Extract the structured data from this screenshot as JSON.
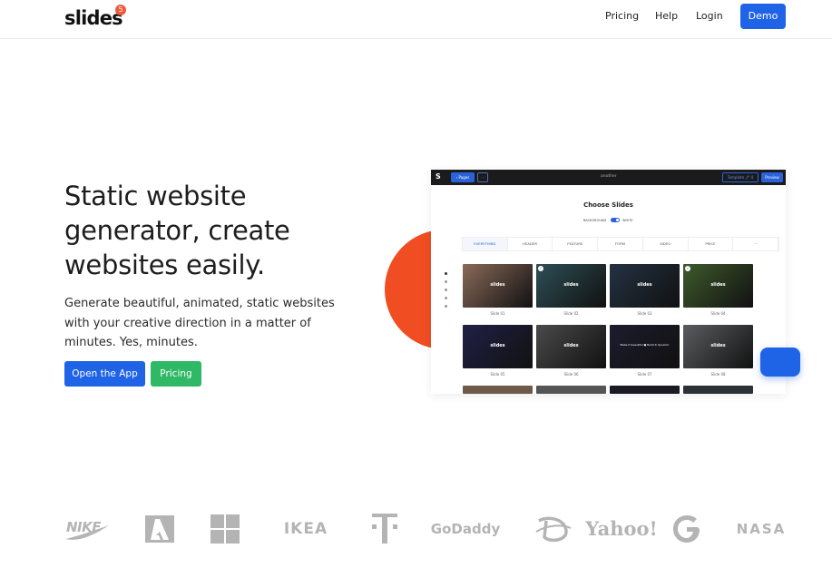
{
  "header": {
    "logo": "slides",
    "logo_badge": "5",
    "nav": {
      "pricing": "Pricing",
      "help": "Help",
      "login": "Login",
      "demo": "Demo"
    }
  },
  "hero": {
    "title": "Static website generator, create websites easily.",
    "subtitle": "Generate beautiful, animated, static websites with your creative direction in a matter of minutes. Yes, minutes.",
    "open_app": "Open the App",
    "pricing": "Pricing"
  },
  "preview": {
    "app_initial": "S",
    "pages_label": "‹ Pages",
    "menu_label": "···",
    "project_name": "another",
    "template_label": "Template 🖊 4",
    "preview_label": "Preview",
    "title": "Choose Slides",
    "toggle_left": "BACKGROUND",
    "toggle_right": "WHITE",
    "tabs": [
      "EVERYTHING",
      "HEADER",
      "FEATURE",
      "FORM",
      "VIDEO",
      "PRICE",
      "···"
    ],
    "active_tab": "EVERYTHING",
    "thumbnails": [
      {
        "caption": "Slide 01",
        "text": "slides",
        "checked": false,
        "color": "#8a6a5a"
      },
      {
        "caption": "Slide 02",
        "text": "slides",
        "checked": true,
        "color": "#2d4f55"
      },
      {
        "caption": "Slide 03",
        "text": "slides",
        "checked": false,
        "color": "#233242"
      },
      {
        "caption": "Slide 04",
        "text": "slides",
        "checked": true,
        "color": "#3e5a2c"
      },
      {
        "caption": "Slide 05",
        "text": "slides",
        "checked": false,
        "color": "#202045"
      },
      {
        "caption": "Slide 06",
        "text": "slides",
        "checked": false,
        "color": "#4a4a4a"
      },
      {
        "caption": "Slide 07",
        "text": "Make it beautiful  ●  Build it dynamic",
        "checked": false,
        "color": "#1c1c2e"
      },
      {
        "caption": "Slide 08",
        "text": "slides",
        "checked": false,
        "color": "#5a5d60"
      }
    ]
  },
  "brands": [
    "NIKE",
    "Adobe",
    "Microsoft",
    "IKEA",
    "T-Mobile",
    "GoDaddy",
    "Disney",
    "Yahoo!",
    "Google",
    "NASA"
  ],
  "colors": {
    "primary": "#1f63e6",
    "success": "#2fb865",
    "accent": "#f04d23"
  }
}
